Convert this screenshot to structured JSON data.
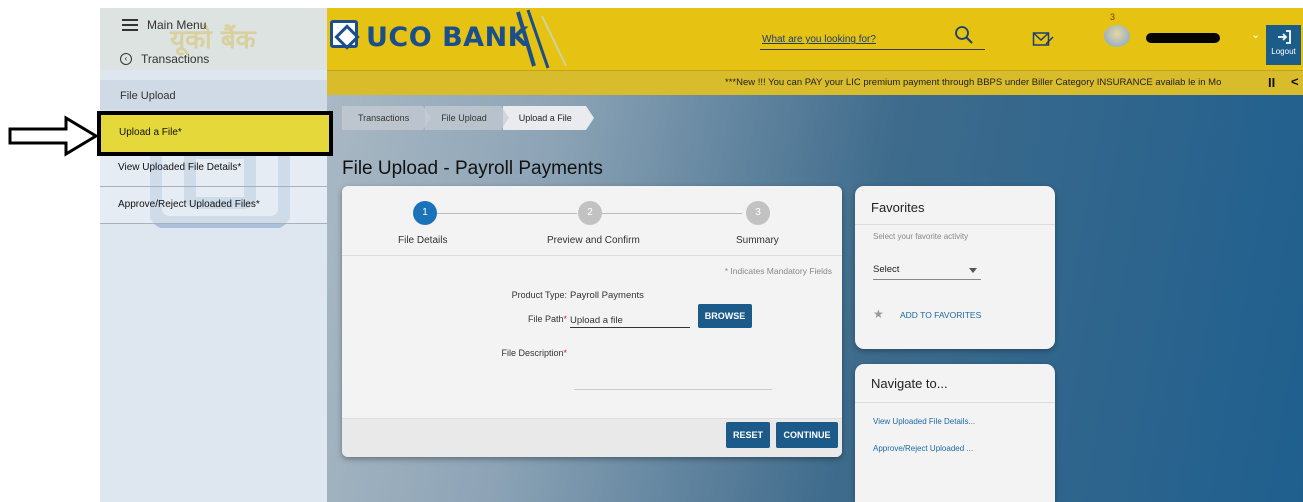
{
  "header": {
    "brand": "UCO BANK",
    "brand_hindi": "यूको बैंक",
    "search_placeholder": "What are you looking for?",
    "notification_count": "3",
    "logout_label": "Logout",
    "ticker": "***New !!! You can PAY your LIC premium payment through BBPS under Biller Category INSURANCE availab le in Mo",
    "ticker_pause": "II",
    "ticker_prev": "<"
  },
  "sidebar": {
    "menu_label": "Main Menu",
    "back_label": "Transactions",
    "section_label": "File Upload",
    "items": [
      {
        "label": "Upload a File*"
      },
      {
        "label": "View Uploaded File Details*"
      },
      {
        "label": "Approve/Reject Uploaded Files*"
      }
    ]
  },
  "breadcrumb": [
    "Transactions",
    "File Upload",
    "Upload a File"
  ],
  "page_title": "File Upload - Payroll Payments",
  "stepper": {
    "steps": [
      {
        "num": "1",
        "label": "File Details"
      },
      {
        "num": "2",
        "label": "Preview and Confirm"
      },
      {
        "num": "3",
        "label": "Summary"
      }
    ]
  },
  "form": {
    "mandatory_note": "* Indicates Mandatory Fields",
    "product_type_label": "Product Type:",
    "product_type_value": "Payroll Payments",
    "file_path_label": "File Path",
    "file_path_value": "Upload a file",
    "browse_label": "BROWSE",
    "description_label": "File Description",
    "required_mark": "*",
    "reset_label": "RESET",
    "continue_label": "CONTINUE"
  },
  "favorites": {
    "title": "Favorites",
    "hint": "Select your favorite activity",
    "select_value": "Select",
    "add_label": "ADD TO FAVORITES"
  },
  "navigate": {
    "title": "Navigate to...",
    "links": [
      "View Uploaded File Details...",
      "Approve/Reject Uploaded ..."
    ]
  },
  "colors": {
    "header_yellow": "#e6c212",
    "brand_blue": "#1b4f8c",
    "button_blue": "#1c5b89",
    "highlight_yellow": "#e4d83a"
  }
}
